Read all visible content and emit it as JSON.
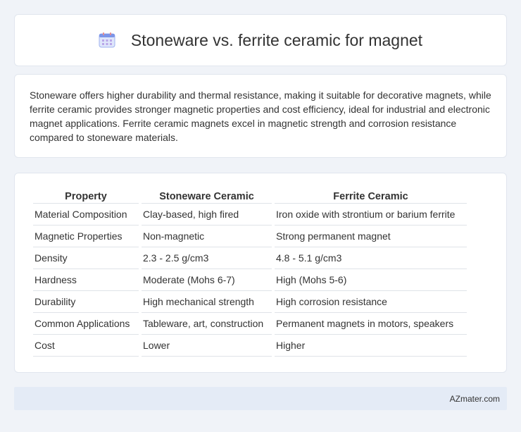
{
  "header": {
    "title": "Stoneware vs. ferrite ceramic for magnet",
    "icon": "calendar-icon"
  },
  "description": "Stoneware offers higher durability and thermal resistance, making it suitable for decorative magnets, while ferrite ceramic provides stronger magnetic properties and cost efficiency, ideal for industrial and electronic magnet applications. Ferrite ceramic magnets excel in magnetic strength and corrosion resistance compared to stoneware materials.",
  "table": {
    "headers": [
      "Property",
      "Stoneware Ceramic",
      "Ferrite Ceramic"
    ],
    "rows": [
      [
        "Material Composition",
        "Clay-based, high fired",
        "Iron oxide with strontium or barium ferrite"
      ],
      [
        "Magnetic Properties",
        "Non-magnetic",
        "Strong permanent magnet"
      ],
      [
        "Density",
        "2.3 - 2.5 g/cm3",
        "4.8 - 5.1 g/cm3"
      ],
      [
        "Hardness",
        "Moderate (Mohs 6-7)",
        "High (Mohs 5-6)"
      ],
      [
        "Durability",
        "High mechanical strength",
        "High corrosion resistance"
      ],
      [
        "Common Applications",
        "Tableware, art, construction",
        "Permanent magnets in motors, speakers"
      ],
      [
        "Cost",
        "Lower",
        "Higher"
      ]
    ]
  },
  "footer": {
    "brand": "AZmater.com"
  }
}
